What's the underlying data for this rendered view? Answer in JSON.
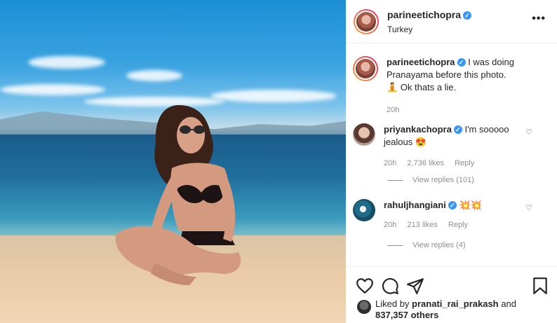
{
  "post": {
    "username": "parineetichopra",
    "location": "Turkey",
    "verified_glyph": "✓"
  },
  "caption": {
    "username": "parineetichopra",
    "text": "I was doing Pranayama before this photo. 🧘 Ok thats a lie.",
    "time": "20h"
  },
  "comments": [
    {
      "username": "priyankachopra",
      "text": "I'm sooooo jealous 😍",
      "time": "20h",
      "likes": "2,736 likes",
      "reply": "Reply",
      "view_replies": "View replies (101)"
    },
    {
      "username": "rahuljhangiani",
      "text": "💥💥",
      "time": "20h",
      "likes": "213 likes",
      "reply": "Reply",
      "view_replies": "View replies (4)"
    }
  ],
  "liked_by": {
    "prefix": "Liked by",
    "user": "pranati_rai_prakash",
    "and": "and",
    "count": "837,357 others"
  },
  "icons": {
    "more": "more-options-icon",
    "like": "heart-icon",
    "comment": "comment-icon",
    "share": "share-icon",
    "save": "bookmark-icon"
  },
  "colors": {
    "verified": "#3897f0",
    "muted": "#8e8e8e",
    "text": "#262626"
  }
}
